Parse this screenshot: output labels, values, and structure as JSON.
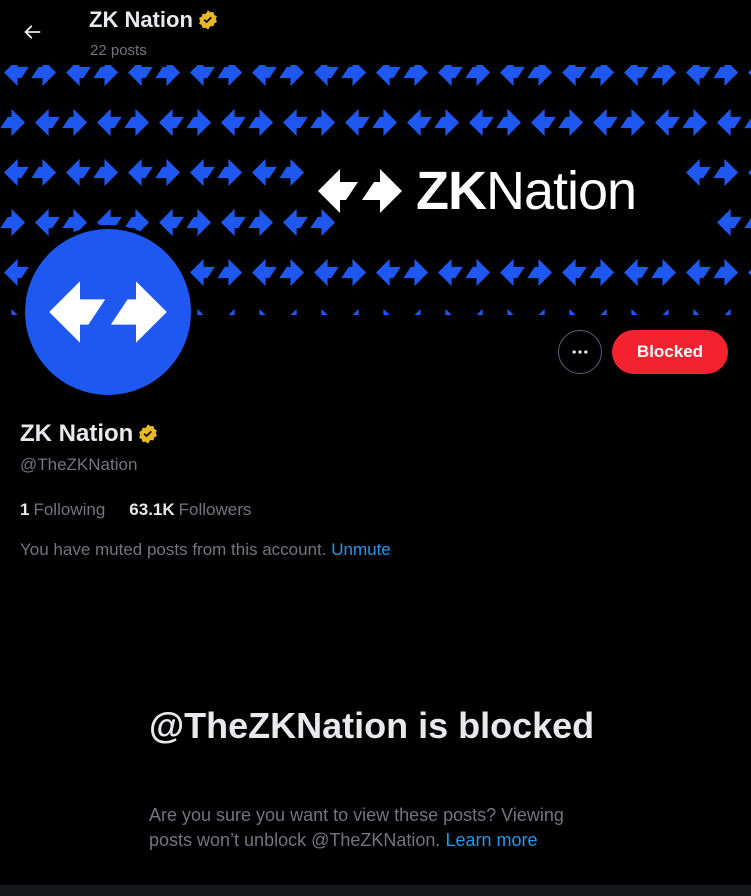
{
  "header": {
    "title": "ZK Nation",
    "post_count": "22 posts"
  },
  "banner": {
    "brand_bold": "ZK",
    "brand_light": "Nation"
  },
  "actions": {
    "blocked_label": "Blocked"
  },
  "profile": {
    "display_name": "ZK Nation",
    "handle": "@TheZKNation",
    "following_count": "1",
    "following_label": "Following",
    "followers_count": "63.1K",
    "followers_label": "Followers",
    "muted_text": "You have muted posts from this account.",
    "unmute_label": "Unmute"
  },
  "blocked_notice": {
    "title": "@TheZKNation is blocked",
    "description": "Are you sure you want to view these posts? Viewing posts won’t unblock @TheZKNation.",
    "learn_more_label": "Learn more"
  },
  "colors": {
    "accent_blue": "#1d9bf0",
    "brand_blue": "#1f58f0",
    "blocked_red": "#f4212e",
    "verified_gold": "#e8b829",
    "background": "#000000"
  },
  "icons": {
    "back": "arrow-left-icon",
    "verified": "verified-badge-icon",
    "more": "more-horizontal-icon",
    "logo": "zk-arrows-logo-icon"
  }
}
